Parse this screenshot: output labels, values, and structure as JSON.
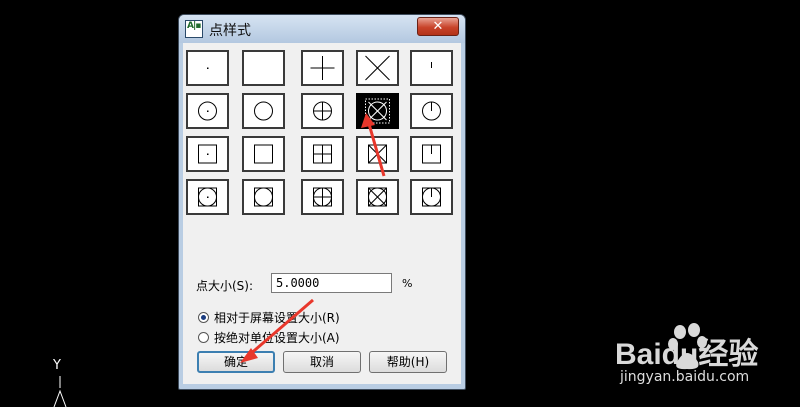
{
  "dialog": {
    "title": "点样式",
    "app_icon_text": "A|▪",
    "close_glyph": "✕"
  },
  "point_styles": {
    "selected_index": 8,
    "tiles": [
      {
        "icon": "point-dot-icon"
      },
      {
        "icon": "point-empty-icon"
      },
      {
        "icon": "point-plus-icon"
      },
      {
        "icon": "point-x-icon"
      },
      {
        "icon": "point-tick-icon"
      },
      {
        "icon": "circle-dot-icon"
      },
      {
        "icon": "circle-empty-icon"
      },
      {
        "icon": "circle-plus-icon"
      },
      {
        "icon": "circle-x-icon"
      },
      {
        "icon": "circle-tick-icon"
      },
      {
        "icon": "square-dot-icon"
      },
      {
        "icon": "square-empty-icon"
      },
      {
        "icon": "square-plus-icon"
      },
      {
        "icon": "square-x-icon"
      },
      {
        "icon": "square-tick-icon"
      },
      {
        "icon": "circle-square-dot-icon"
      },
      {
        "icon": "circle-square-empty-icon"
      },
      {
        "icon": "circle-square-plus-icon"
      },
      {
        "icon": "circle-square-x-icon"
      },
      {
        "icon": "circle-square-tick-icon"
      }
    ]
  },
  "size": {
    "label": "点大小(S):",
    "value": "5.0000",
    "unit": "%"
  },
  "mode": {
    "relative_label": "相对于屏幕设置大小(R)",
    "absolute_label": "按绝对单位设置大小(A)",
    "selected": "relative"
  },
  "buttons": {
    "ok": "确定",
    "cancel": "取消",
    "help": "帮助(H)"
  },
  "ucs": {
    "y_label": "Y"
  },
  "watermark": {
    "brand": "Baidu经验",
    "url": "jingyan.baidu.com"
  },
  "annotation_color": "#e8372b"
}
